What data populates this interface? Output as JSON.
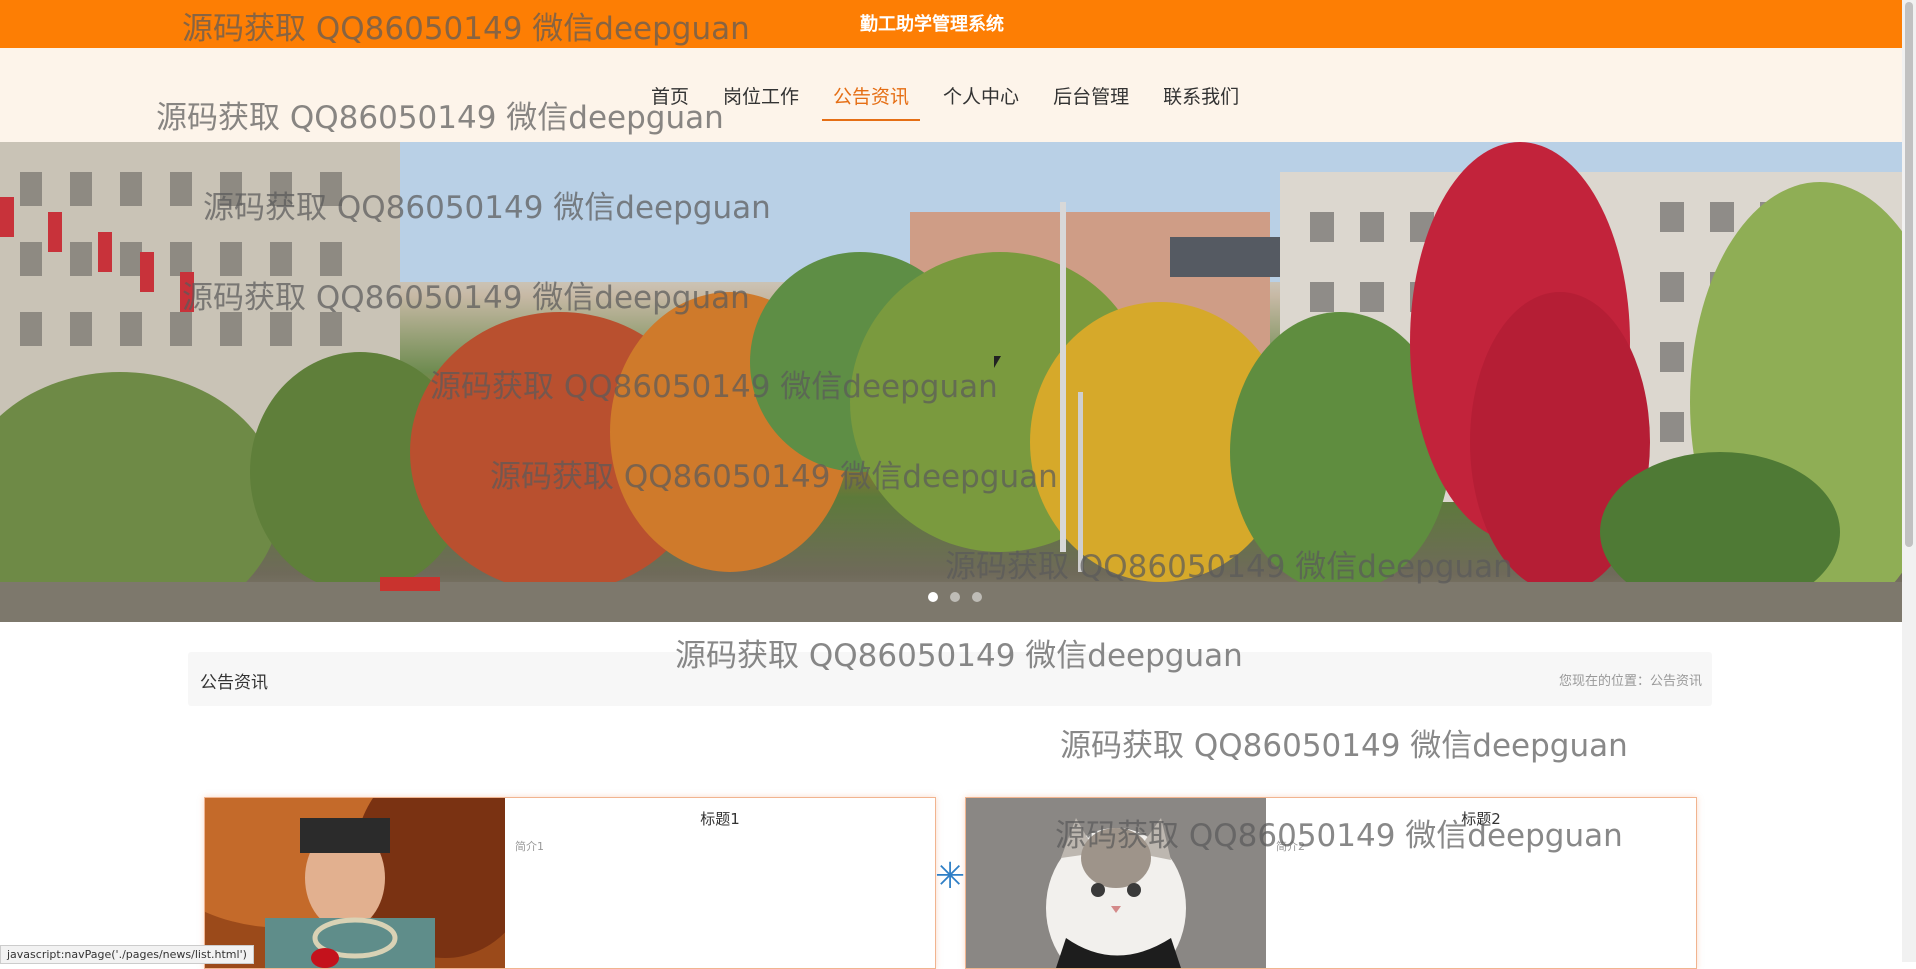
{
  "header": {
    "system_title": "勤工助学管理系统"
  },
  "nav": {
    "items": [
      {
        "label": "首页"
      },
      {
        "label": "岗位工作"
      },
      {
        "label": "公告资讯"
      },
      {
        "label": "个人中心"
      },
      {
        "label": "后台管理"
      },
      {
        "label": "联系我们"
      }
    ],
    "active_index": 2
  },
  "banner": {
    "slide_count": 3,
    "active_slide": 1
  },
  "breadcrumb": {
    "title": "公告资讯",
    "location": "您现在的位置：公告资讯"
  },
  "news": [
    {
      "title": "标题1",
      "summary": "简介1"
    },
    {
      "title": "标题2",
      "summary": "简介2"
    }
  ],
  "watermark": "源码获取 QQ86050149 微信deepguan",
  "status_bar": "javascript:navPage('./pages/news/list.html')",
  "colors": {
    "accent": "#fd7e04",
    "nav_bg": "#fdf4ea",
    "active_nav": "#e56e14"
  }
}
